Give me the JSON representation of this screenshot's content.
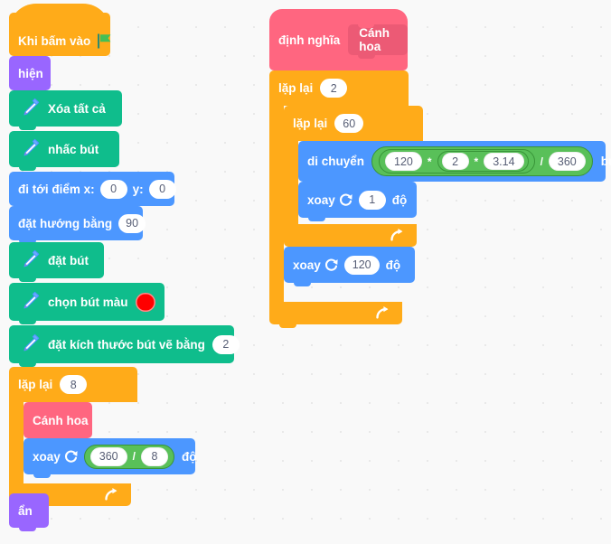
{
  "app": {
    "type": "scratch-block-editor",
    "language": "vi",
    "canvas_background": "#f9f9f9",
    "grid_dot_color": "#e9e9e9"
  },
  "palette": {
    "events": "#ffab19",
    "control": "#ffab19",
    "looks": "#9966ff",
    "motion": "#4c97ff",
    "pen": "#0fbd8c",
    "my_blocks": "#ff6680",
    "operators": "#59c059",
    "pen_color_value": "#ff0000"
  },
  "scripts": {
    "main": {
      "hat": {
        "label": "Khi bấm vào",
        "icon": "green-flag-icon"
      },
      "blocks": [
        {
          "id": "show",
          "label": "hiện",
          "category": "looks"
        },
        {
          "id": "erase_all",
          "label": "Xóa tất cả",
          "category": "pen",
          "icon": "pen-icon"
        },
        {
          "id": "pen_up",
          "label": "nhấc bút",
          "category": "pen",
          "icon": "pen-icon"
        },
        {
          "id": "goto_xy",
          "label_x": "đi tới điểm x:",
          "value_x": "0",
          "label_y": "y:",
          "value_y": "0",
          "category": "motion"
        },
        {
          "id": "point_dir",
          "label": "đặt hướng bằng",
          "value": "90",
          "category": "motion"
        },
        {
          "id": "pen_down",
          "label": "đặt bút",
          "category": "pen",
          "icon": "pen-icon"
        },
        {
          "id": "set_color",
          "label": "chọn bút màu",
          "value": "#ff0000",
          "category": "pen",
          "icon": "pen-icon"
        },
        {
          "id": "set_size",
          "label": "đặt kích thước bút vẽ bằng",
          "value": "2",
          "category": "pen",
          "icon": "pen-icon"
        }
      ],
      "repeat": {
        "label": "lặp lại",
        "value": "8",
        "loop_icon": "loop-arrow-icon",
        "body": [
          {
            "id": "call_petal",
            "label": "Cánh hoa",
            "category": "my_blocks"
          },
          {
            "id": "turn_right",
            "label": "xoay",
            "unit": "độ",
            "icon": "turn-clockwise-icon",
            "category": "motion",
            "operator": {
              "type": "divide",
              "left": "360",
              "symbol": "/",
              "right": "8"
            }
          }
        ]
      },
      "tail": {
        "id": "hide",
        "label": "ẩn",
        "category": "looks"
      }
    },
    "definition": {
      "hat": {
        "label": "định nghĩa",
        "proto_name": "Cánh hoa"
      },
      "outer_repeat": {
        "label": "lặp lại",
        "value": "2",
        "loop_icon": "loop-arrow-icon",
        "inner_repeat": {
          "label": "lặp lại",
          "value": "60",
          "loop_icon": "loop-arrow-icon",
          "body": [
            {
              "id": "move_steps",
              "label": "di chuyển",
              "unit": "bước",
              "category": "motion",
              "operator": {
                "type": "divide",
                "symbol": "/",
                "right": "360",
                "left": {
                  "type": "multiply",
                  "symbol": "*",
                  "left": "120",
                  "right": {
                    "type": "multiply",
                    "symbol": "*",
                    "left": "2",
                    "right": "3.14"
                  }
                }
              }
            },
            {
              "id": "turn_1",
              "label": "xoay",
              "value": "1",
              "unit": "độ",
              "icon": "turn-clockwise-icon",
              "category": "motion"
            }
          ]
        },
        "after_inner": {
          "id": "turn_120",
          "label": "xoay",
          "value": "120",
          "unit": "độ",
          "icon": "turn-clockwise-icon",
          "category": "motion"
        }
      }
    }
  }
}
